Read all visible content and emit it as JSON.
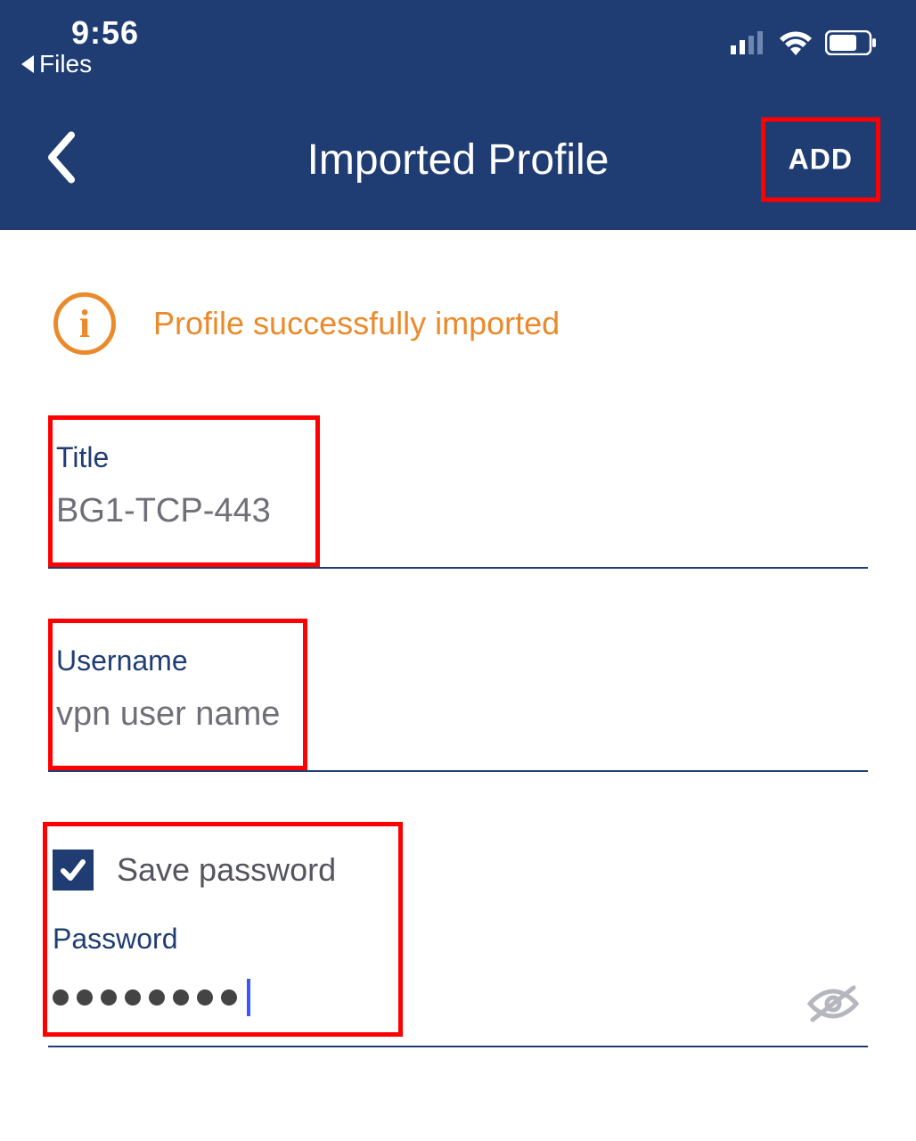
{
  "status_bar": {
    "time": "9:56",
    "back_app_label": "Files"
  },
  "header": {
    "title": "Imported Profile",
    "add_label": "ADD"
  },
  "info_banner": {
    "icon_letter": "i",
    "message": "Profile successfully imported"
  },
  "fields": {
    "title": {
      "label": "Title",
      "value": "BG1-TCP-443"
    },
    "username": {
      "label": "Username",
      "value": "vpn user name"
    },
    "password": {
      "save_checkbox_label": "Save password",
      "save_checked": true,
      "label": "Password",
      "masked_value": "●●●●●●●●",
      "dot_count": 8
    }
  },
  "colors": {
    "header_bg": "#1f3d73",
    "accent_orange": "#ea8a2a",
    "highlight_red": "#ff0000"
  }
}
